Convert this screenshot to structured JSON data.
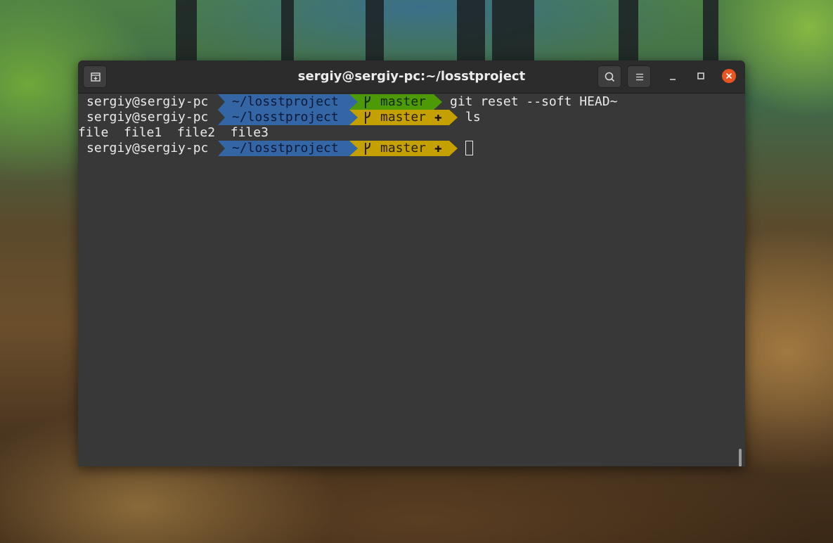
{
  "window": {
    "title": "sergiy@sergiy-pc:~/losstproject"
  },
  "titlebar_icons": {
    "new_tab": "new-tab-icon",
    "search": "search-icon",
    "menu": "hamburger-menu-icon",
    "minimize": "minimize-icon",
    "maximize": "maximize-icon",
    "close": "close-icon"
  },
  "terminal": {
    "lines": [
      {
        "user": "sergiy@sergiy-pc",
        "path": "~/losstproject",
        "branch_icon": "git-branch-icon",
        "branch": "master",
        "dirty": false,
        "command": "git reset --soft HEAD~"
      },
      {
        "user": "sergiy@sergiy-pc",
        "path": "~/losstproject",
        "branch_icon": "git-branch-icon",
        "branch": "master",
        "dirty": true,
        "dirty_symbol": "✚",
        "command": "ls"
      },
      {
        "user": "sergiy@sergiy-pc",
        "path": "~/losstproject",
        "branch_icon": "git-branch-icon",
        "branch": "master",
        "dirty": true,
        "dirty_symbol": "✚",
        "command": ""
      }
    ],
    "ls_output": "file  file1  file2  file3"
  },
  "colors": {
    "path_segment": "#3465a4",
    "branch_clean": "#4e9a06",
    "branch_dirty": "#c4a000",
    "close_button": "#e95420",
    "terminal_bg": "#383838",
    "titlebar_bg": "#2c2c2c"
  }
}
